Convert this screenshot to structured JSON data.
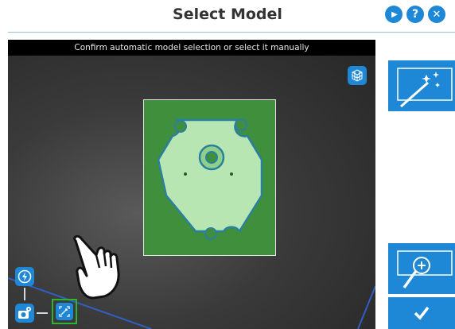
{
  "header": {
    "title": "Select Model",
    "buttons": [
      {
        "icon": "play-icon",
        "glyph": "▶"
      },
      {
        "icon": "help-icon",
        "glyph": "?"
      },
      {
        "icon": "close-icon",
        "glyph": "✕"
      }
    ]
  },
  "viewer": {
    "instruction": "Confirm automatic model selection or select it manually"
  },
  "toolbar_left": {
    "flash": "lightning-icon",
    "camera": "camera-settings-icon",
    "roi": "roi-select-icon"
  },
  "sidebar": {
    "auto_select": "magic-wand-icon",
    "zoom": "zoom-in-icon",
    "confirm": "checkmark-icon"
  },
  "colors": {
    "accent": "#1e88d6",
    "roi_highlight": "#2db52d",
    "model_overlay": "#3f8f3c"
  }
}
